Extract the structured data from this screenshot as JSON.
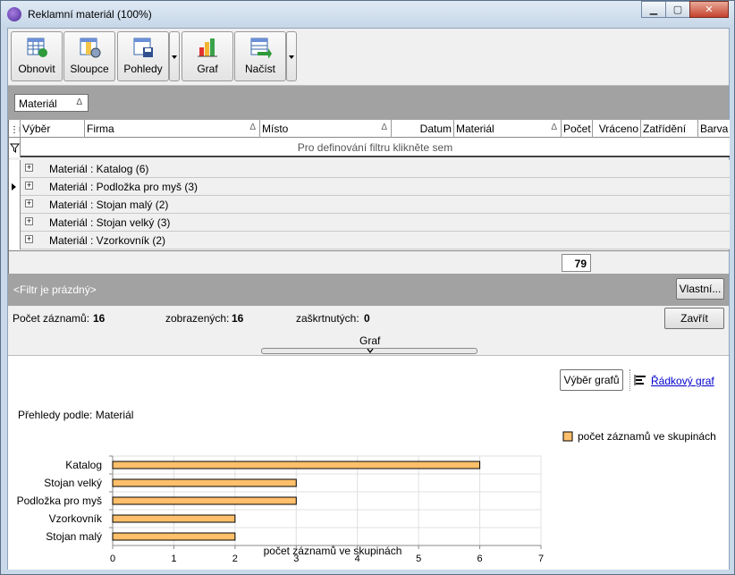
{
  "window": {
    "title": "Reklamní materiál (100%)",
    "icon": "app-logo-icon"
  },
  "toolbar": {
    "buttons": [
      {
        "label": "Obnovit",
        "icon": "refresh-grid-icon"
      },
      {
        "label": "Sloupce",
        "icon": "columns-settings-icon"
      },
      {
        "label": "Pohledy",
        "icon": "views-save-icon"
      },
      {
        "label": "Graf",
        "icon": "bar-chart-icon"
      },
      {
        "label": "Načíst",
        "icon": "load-grid-icon"
      }
    ]
  },
  "group_by": {
    "label": "Materiál",
    "sort_glyph": "Δ"
  },
  "grid": {
    "columns": [
      {
        "label": "Výběr",
        "sort": ""
      },
      {
        "label": "Firma",
        "sort": "Δ"
      },
      {
        "label": "Místo",
        "sort": "Δ"
      },
      {
        "label": "Datum",
        "sort": ""
      },
      {
        "label": "Materiál",
        "sort": "Δ"
      },
      {
        "label": "Počet",
        "sort": ""
      },
      {
        "label": "Vráceno",
        "sort": ""
      },
      {
        "label": "Zatřídění",
        "sort": ""
      },
      {
        "label": "Barva",
        "sort": ""
      }
    ],
    "filter_prompt": "Pro definování filtru klikněte sem",
    "groups": [
      "Materiál : Katalog (6)",
      "Materiál : Podložka pro myš (3)",
      "Materiál : Stojan malý (2)",
      "Materiál : Stojan velký (3)",
      "Materiál : Vzorkovník (2)"
    ],
    "current_row": 1,
    "sum": "79"
  },
  "filter_status": {
    "text": "<Filtr je prázdný>",
    "custom_button": "Vlastní..."
  },
  "stats": {
    "records_label": "Počet záznamů:",
    "records_value": "16",
    "shown_label": "zobrazených:",
    "shown_value": "16",
    "checked_label": "zaškrtnutých:",
    "checked_value": "0",
    "close_button": "Zavřít"
  },
  "chart_panel": {
    "splitter_label": "Graf",
    "select_button": "Výběr grafů",
    "type_link": "Řádkový graf",
    "overview_label": "Přehledy podle: Materiál"
  },
  "chart_data": {
    "type": "bar",
    "orientation": "horizontal",
    "categories": [
      "Katalog",
      "Stojan velký",
      "Podložka pro myš",
      "Vzorkovník",
      "Stojan malý"
    ],
    "series": [
      {
        "name": "počet záznamů ve skupinách",
        "values": [
          6,
          3,
          3,
          2,
          2
        ]
      }
    ],
    "xlabel": "počet záznamů ve skupinách",
    "ylabel": "",
    "xlim": [
      0,
      7
    ],
    "x_ticks": [
      "0",
      "1",
      "2",
      "3",
      "4",
      "5",
      "6",
      "7"
    ],
    "grid": true,
    "legend": "right",
    "bar_color": "#ffbf6b",
    "bar_stroke": "#000000"
  }
}
